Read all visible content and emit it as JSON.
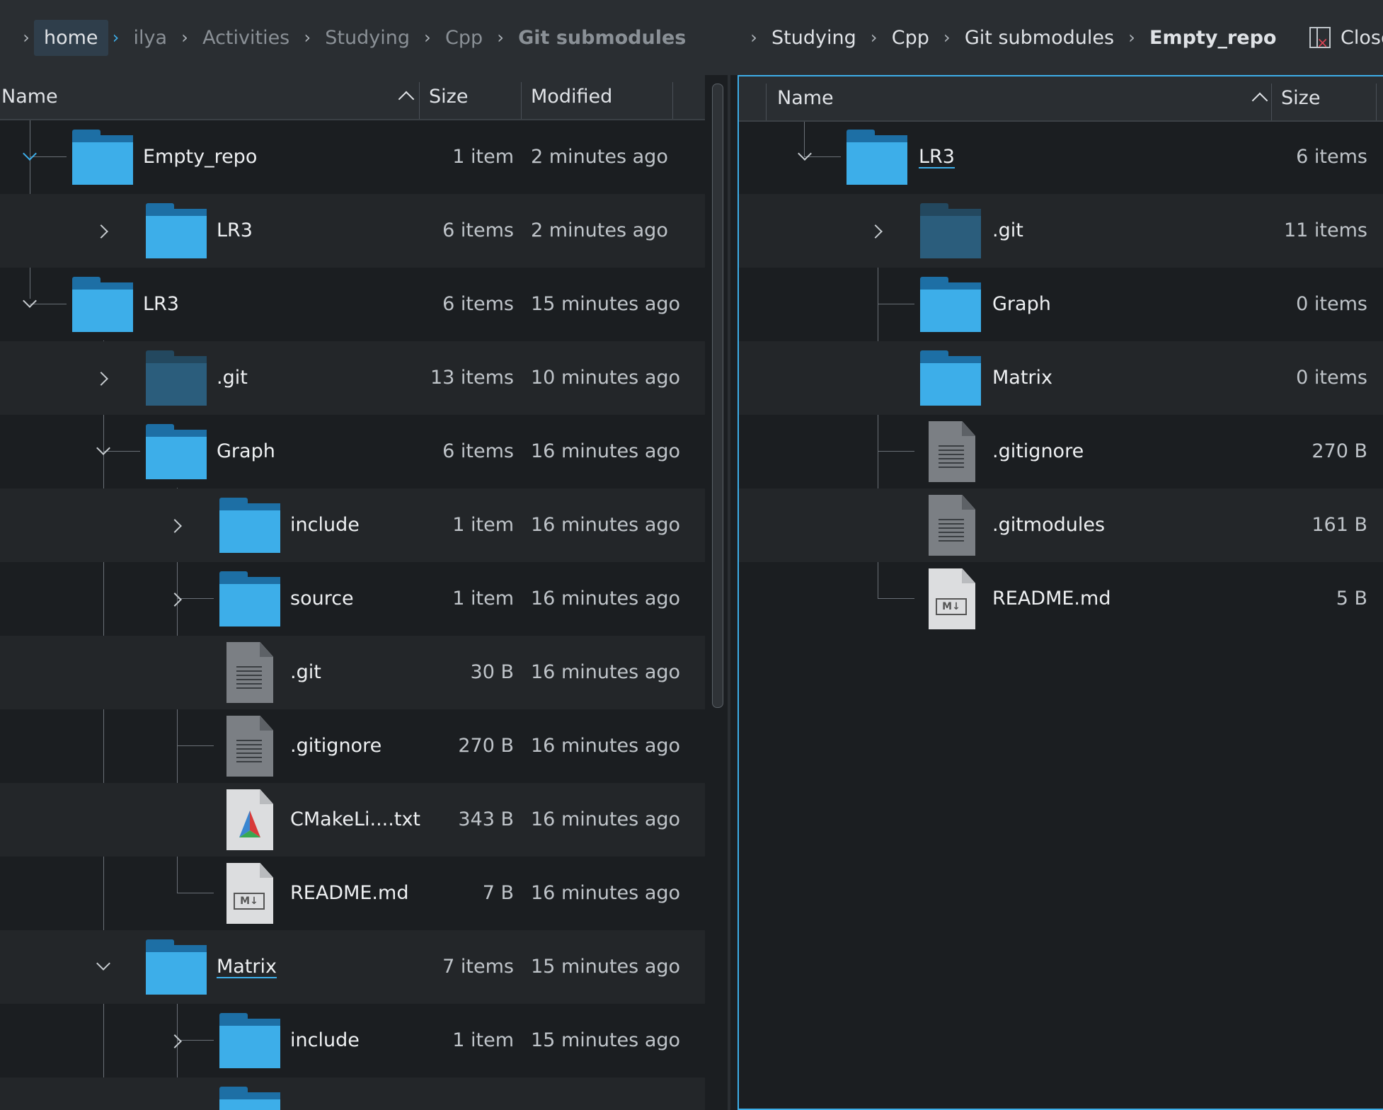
{
  "left_breadcrumb": [
    "home",
    "ilya",
    "Activities",
    "Studying",
    "Cpp",
    "Git submodules"
  ],
  "right_breadcrumb": [
    "Studying",
    "Cpp",
    "Git submodules",
    "Empty_repo"
  ],
  "close_label": "Close",
  "left_columns": {
    "name": "Name",
    "size": "Size",
    "modified": "Modified"
  },
  "right_columns": {
    "name": "Name",
    "size": "Size"
  },
  "left_rows": [
    {
      "name": "Empty_repo",
      "size": "1 item",
      "modified": "2 minutes ago",
      "icon": "folder-icon"
    },
    {
      "name": "LR3",
      "size": "6 items",
      "modified": "2 minutes ago",
      "icon": "folder-icon"
    },
    {
      "name": "LR3",
      "size": "6 items",
      "modified": "15 minutes ago",
      "icon": "folder-icon"
    },
    {
      "name": ".git",
      "size": "13 items",
      "modified": "10 minutes ago",
      "icon": "hidden-folder-icon"
    },
    {
      "name": "Graph",
      "size": "6 items",
      "modified": "16 minutes ago",
      "icon": "folder-icon"
    },
    {
      "name": "include",
      "size": "1 item",
      "modified": "16 minutes ago",
      "icon": "folder-icon"
    },
    {
      "name": "source",
      "size": "1 item",
      "modified": "16 minutes ago",
      "icon": "folder-icon"
    },
    {
      "name": ".git",
      "size": "30 B",
      "modified": "16 minutes ago",
      "icon": "text-file-icon"
    },
    {
      "name": ".gitignore",
      "size": "270 B",
      "modified": "16 minutes ago",
      "icon": "text-file-icon"
    },
    {
      "name": "CMakeLi....txt",
      "size": "343 B",
      "modified": "16 minutes ago",
      "icon": "cmake-file-icon"
    },
    {
      "name": "README.md",
      "size": "7 B",
      "modified": "16 minutes ago",
      "icon": "markdown-file-icon"
    },
    {
      "name": "Matrix",
      "size": "7 items",
      "modified": "15 minutes ago",
      "icon": "folder-icon"
    },
    {
      "name": "include",
      "size": "1 item",
      "modified": "15 minutes ago",
      "icon": "folder-icon"
    }
  ],
  "right_rows": [
    {
      "name": "LR3",
      "size": "6 items",
      "icon": "folder-icon"
    },
    {
      "name": ".git",
      "size": "11 items",
      "icon": "hidden-folder-icon"
    },
    {
      "name": "Graph",
      "size": "0 items",
      "icon": "folder-icon"
    },
    {
      "name": "Matrix",
      "size": "0 items",
      "icon": "folder-icon"
    },
    {
      "name": ".gitignore",
      "size": "270 B",
      "icon": "text-file-icon"
    },
    {
      "name": ".gitmodules",
      "size": "161 B",
      "icon": "text-file-icon"
    },
    {
      "name": "README.md",
      "size": "5 B",
      "icon": "markdown-file-icon"
    }
  ],
  "icons": {
    "markdown_glyph": "M↓"
  },
  "colors": {
    "accent": "#3daee9",
    "folder": "#3daee9",
    "folder_dark": "#2b5d7c",
    "background": "#1b1e21",
    "row_alt": "#232629"
  }
}
